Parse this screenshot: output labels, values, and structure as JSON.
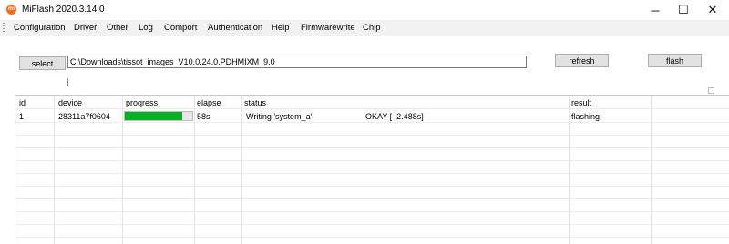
{
  "window": {
    "title": "MiFlash 2020.3.14.0",
    "icon": "mi-logo-icon",
    "icon_text": "mi",
    "minimize": "─",
    "maximize": "☐",
    "close": "✕"
  },
  "menu": {
    "items": [
      "Configuration",
      "Driver",
      "Other",
      "Log",
      "Comport",
      "Authentication",
      "Help",
      "Firmwarewrite",
      "Chip"
    ]
  },
  "toolbar": {
    "select_label": "select",
    "path_value": "C:\\Downloads\\tissot_images_V10.0.24.0.PDHMIXM_9.0",
    "refresh_label": "refresh",
    "flash_label": "flash"
  },
  "table": {
    "columns": [
      "id",
      "device",
      "progress",
      "elapse",
      "status",
      "result"
    ],
    "rows": [
      {
        "id": "1",
        "device": "28311a7f0604",
        "progress": 0.85,
        "elapse": "58s",
        "status": "Writing 'system_a'",
        "status_detail": "OKAY [  2.488s]",
        "result": "flashing"
      }
    ]
  },
  "colors": {
    "progress_fill": "#06b025",
    "app_icon": "#f36b21"
  }
}
